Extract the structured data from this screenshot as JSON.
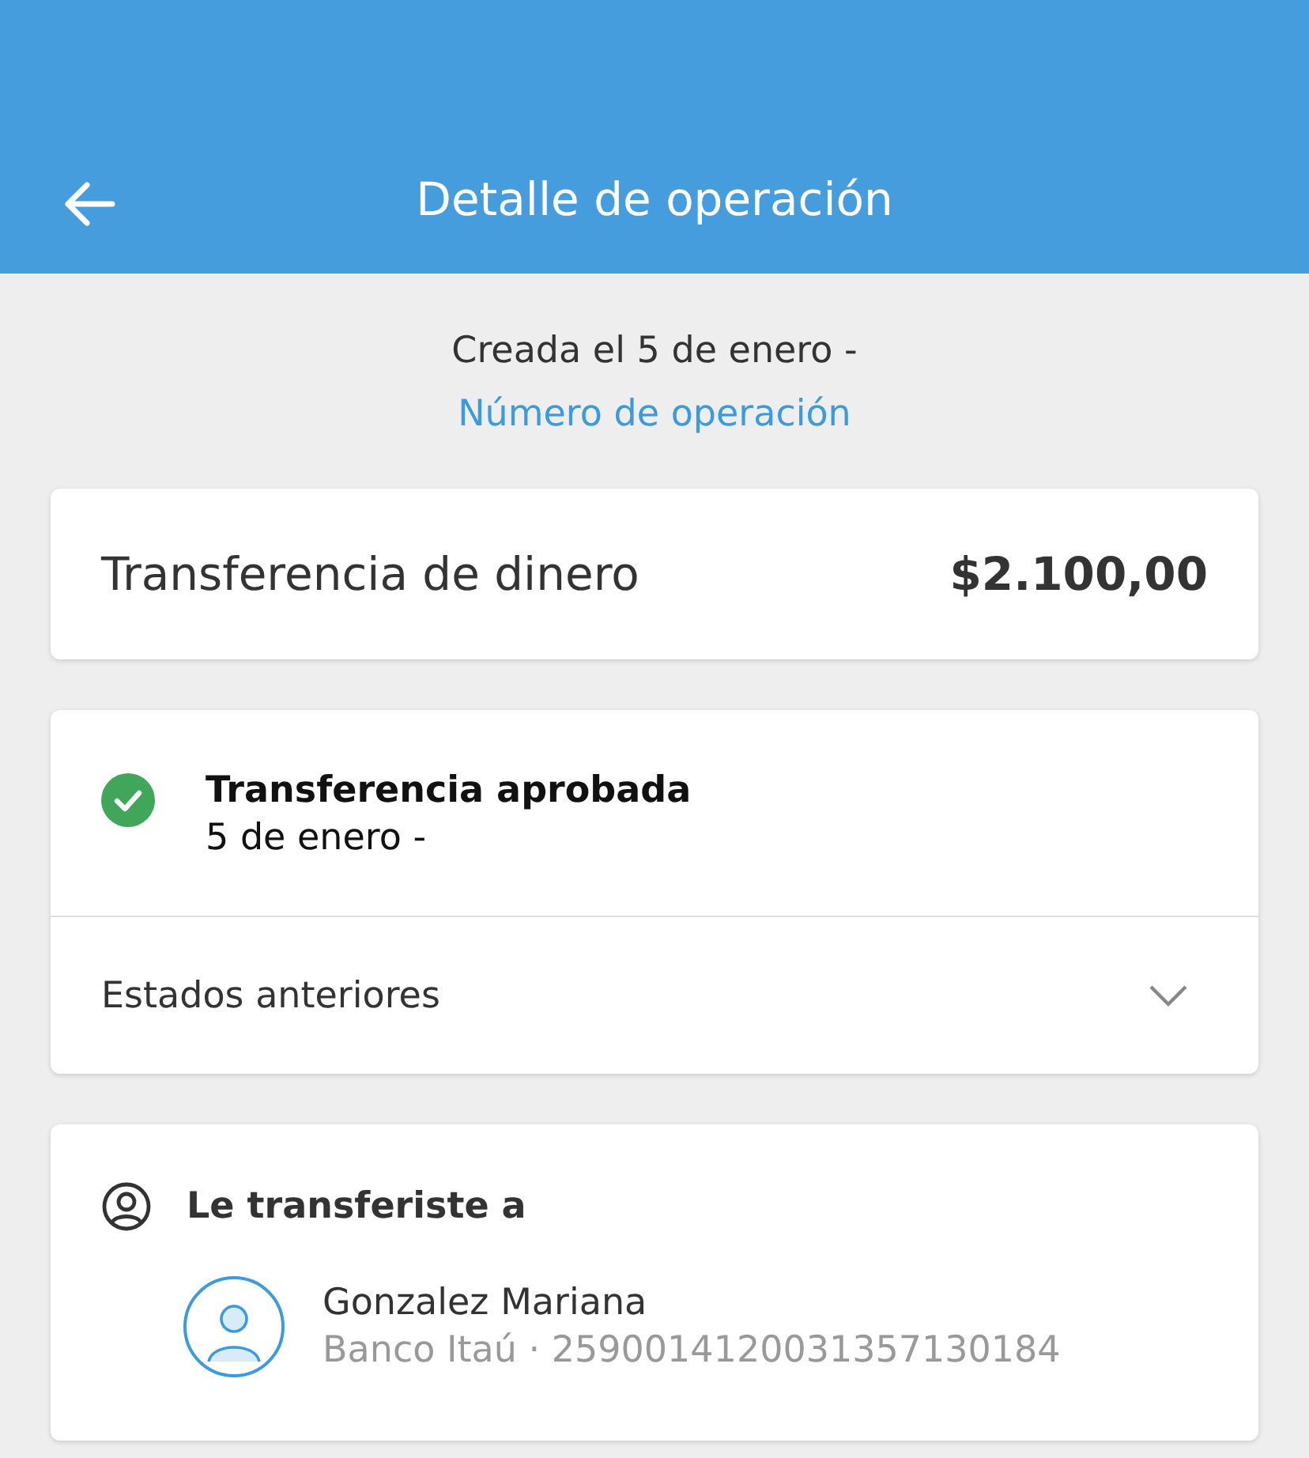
{
  "header": {
    "title": "Detalle de operación"
  },
  "meta": {
    "created": "Creada el 5 de enero -",
    "operation_link": "Número de operación"
  },
  "summary": {
    "label": "Transferencia de dinero",
    "currency": "$",
    "amount": "2.100,00"
  },
  "status": {
    "title": "Transferencia aprobada",
    "date": "5 de enero -",
    "approved": true,
    "history_label": "Estados anteriores",
    "expanded": false
  },
  "recipient": {
    "heading": "Le transferiste a",
    "name": "Gonzalez Mariana",
    "detail": "Banco Itaú · 2590014120031357130184"
  }
}
